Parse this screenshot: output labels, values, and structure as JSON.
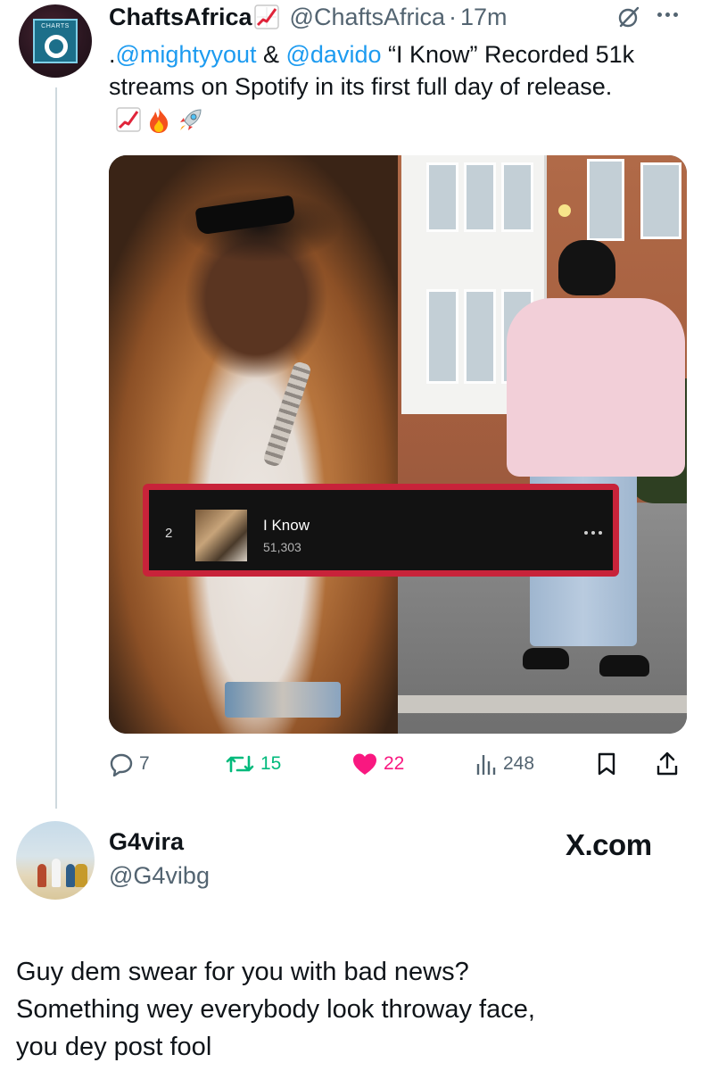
{
  "tweet1": {
    "display_name": "ChaftsAfrica",
    "handle": "@ChaftsAfrica",
    "separator": "·",
    "time": "17m",
    "avatar_label": "CHARTS",
    "text_prefix": ".",
    "mention1": "@mightyyout",
    "text_mid": " & ",
    "mention2": "@davido",
    "text_rest": " “I Know” Recorded 51k streams on Spotify in its first full day of release.",
    "emojis": [
      "chart-increasing",
      "fire",
      "rocket"
    ],
    "media": {
      "spotify_rank": "2",
      "spotify_title": "I Know",
      "spotify_streams": "51,303"
    },
    "actions": {
      "replies": "7",
      "reposts": "15",
      "likes": "22",
      "views": "248"
    }
  },
  "tweet2": {
    "display_name": "G4vira",
    "handle": "@G4vibg",
    "source_label": "X.com",
    "lines": [
      "Guy dem swear for you with bad news?",
      "Something wey everybody look throway face,",
      "you dey post fool"
    ]
  },
  "colors": {
    "link": "#1d9bf0",
    "secondary_text": "#536471",
    "repost": "#00ba7c",
    "like": "#f91880",
    "spotify_highlight": "#c8233a"
  }
}
